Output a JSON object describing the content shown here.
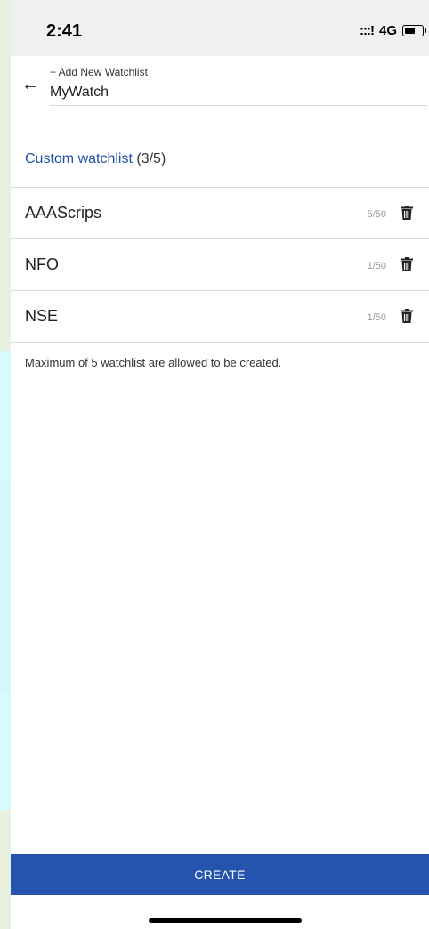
{
  "status_bar": {
    "time": "2:41",
    "signal": ":::!",
    "network": "4G"
  },
  "header": {
    "add_label": "+ Add New Watchlist",
    "watchlist_name": "MyWatch"
  },
  "section": {
    "title": "Custom watchlist",
    "count": "(3/5)"
  },
  "watchlists": [
    {
      "name": "AAAScrips",
      "count": "5/50"
    },
    {
      "name": "NFO",
      "count": "1/50"
    },
    {
      "name": "NSE",
      "count": "1/50"
    }
  ],
  "note": "Maximum of 5 watchlist are allowed to be created.",
  "create_label": "CREATE",
  "colors": {
    "accent": "#2251a8",
    "button": "#2554ae"
  }
}
